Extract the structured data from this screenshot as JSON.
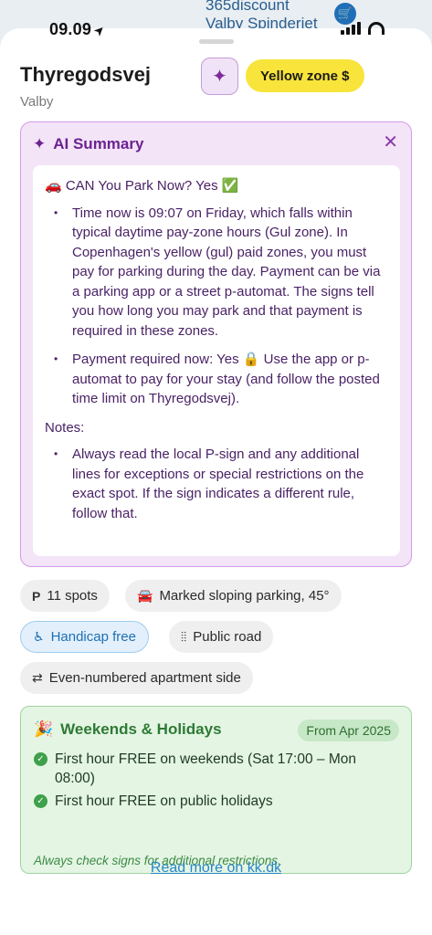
{
  "status_bar": {
    "time": "09.09"
  },
  "map": {
    "label_line1": "365discount",
    "label_line2": "Valby Spinderiet"
  },
  "header": {
    "title": "Thyregodsvej",
    "subtitle": "Valby",
    "zone_badge": "Yellow zone $"
  },
  "ai_summary": {
    "title": "AI Summary",
    "headline": "🚗 CAN You Park Now? Yes ✅",
    "bullets": [
      "Time now is 09:07 on Friday, which falls within typical daytime pay-zone hours (Gul zone). In Copenhagen's yellow (gul) paid zones, you must pay for parking during the day. Payment can be via a parking app or a street p-automat. The signs tell you how long you may park and that payment is required in these zones.",
      "Payment required now: Yes 🔒 Use the app or p-automat to pay for your stay (and follow the posted time limit on Thyregodsvej)."
    ],
    "notes_label": "Notes:",
    "notes_bullets": [
      "Always read the local P-sign and any additional lines for exceptions or special restrictions on the exact spot. If the sign indicates a different rule, follow that."
    ]
  },
  "chips": {
    "spots": "11 spots",
    "parking_type": "Marked sloping parking, 45°",
    "handicap": "Handicap free",
    "road_type": "Public road",
    "side": "Even-numbered apartment side"
  },
  "weekends": {
    "title": "Weekends & Holidays",
    "badge": "From Apr 2025",
    "items": [
      "First hour FREE on weekends (Sat 17:00 – Mon 08:00)",
      "First hour FREE on public holidays"
    ],
    "note": "Always check signs for additional restrictions."
  },
  "read_more": "Read more on kk.dk",
  "icons": {
    "ai": "sparkles-icon",
    "close": "close-icon",
    "car": "car-icon",
    "wheelchair": "wheelchair-icon",
    "road": "road-icon",
    "swap": "arrows-swap-icon",
    "party": "party-popper-icon",
    "check": "check-circle-icon"
  },
  "colors": {
    "zone_yellow": "#f8e43a",
    "ai_purple": "#6b2290",
    "ai_bg": "#f3e4f8",
    "green_card": "#e4f5e4",
    "link_blue": "#2a86c8"
  }
}
